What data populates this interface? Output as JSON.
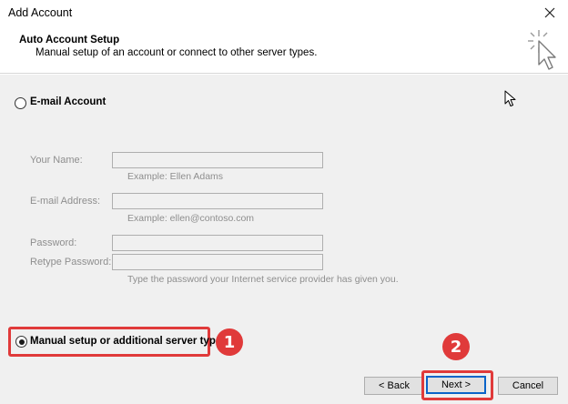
{
  "window": {
    "title": "Add Account",
    "close_icon": "close-icon"
  },
  "header": {
    "title": "Auto Account Setup",
    "subtitle": "Manual setup of an account or connect to other server types.",
    "icon": "wizard-cursor-icon"
  },
  "options": {
    "email_account": {
      "label": "E-mail Account",
      "selected": false
    },
    "manual_setup": {
      "label": "Manual setup or additional server types",
      "selected": true
    }
  },
  "fields": {
    "your_name": {
      "label": "Your Name:",
      "value": "",
      "hint": "Example: Ellen Adams"
    },
    "email_address": {
      "label": "E-mail Address:",
      "value": "",
      "hint": "Example: ellen@contoso.com"
    },
    "password": {
      "label": "Password:",
      "value": ""
    },
    "retype_password": {
      "label": "Retype Password:",
      "value": "",
      "hint": "Type the password your Internet service provider has given you."
    }
  },
  "annotations": {
    "step1": "1",
    "step2": "2",
    "color": "#e03a3a"
  },
  "buttons": {
    "back": "< Back",
    "next": "Next >",
    "cancel": "Cancel"
  }
}
